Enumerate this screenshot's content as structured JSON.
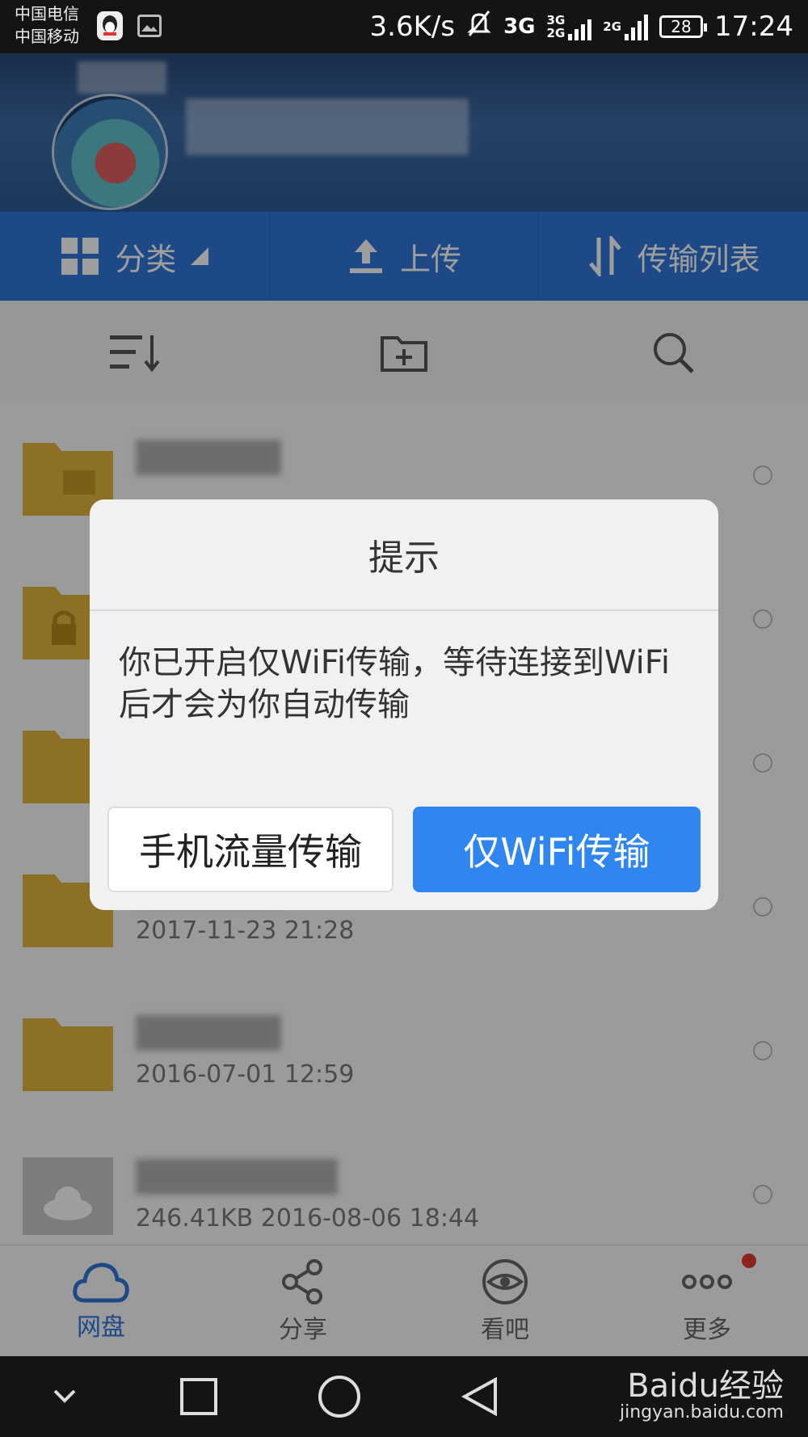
{
  "status_bar": {
    "carrier1": "中国电信",
    "carrier2": "中国移动",
    "speed": "3.6K/s",
    "net1": "3G",
    "net2_top": "3G",
    "net2_bottom": "2G",
    "net3": "2G",
    "battery": "28",
    "time": "17:24",
    "icons": [
      "qq-icon",
      "gallery-icon",
      "mute-icon",
      "signal-icon",
      "battery-icon"
    ]
  },
  "tabs": [
    {
      "label": "分类",
      "icon": "grid-icon"
    },
    {
      "label": "上传",
      "icon": "upload-icon"
    },
    {
      "label": "传输列表",
      "icon": "transfer-icon"
    }
  ],
  "toolbar": {
    "icons": [
      "sort-icon",
      "new-folder-icon",
      "search-icon"
    ]
  },
  "files": [
    {
      "meta": "",
      "icon": "folder-icon"
    },
    {
      "meta": "",
      "icon": "folder-lock-icon"
    },
    {
      "meta": "",
      "icon": "folder-icon"
    },
    {
      "meta": "2017-11-23  21:28",
      "icon": "folder-icon"
    },
    {
      "meta": "2016-07-01  12:59",
      "icon": "folder-icon"
    },
    {
      "meta": "246.41KB  2016-08-06  18:44",
      "icon": "cloud-file-icon"
    }
  ],
  "bottom_nav": [
    {
      "label": "网盘",
      "icon": "cloud-icon",
      "active": true
    },
    {
      "label": "分享",
      "icon": "share-icon",
      "active": false
    },
    {
      "label": "看吧",
      "icon": "eye-icon",
      "active": false
    },
    {
      "label": "更多",
      "icon": "more-icon",
      "active": false
    }
  ],
  "dialog": {
    "title": "提示",
    "message": "你已开启仅WiFi传输，等待连接到WiFi后才会为你自动传输",
    "btn_mobile": "手机流量传输",
    "btn_wifi": "仅WiFi传输"
  },
  "watermark": {
    "brand": "Baidu经验",
    "url": "jingyan.baidu.com"
  },
  "colors": {
    "accent": "#2f78d8",
    "button_blue": "#2f86f0",
    "badge_red": "#e53935"
  }
}
